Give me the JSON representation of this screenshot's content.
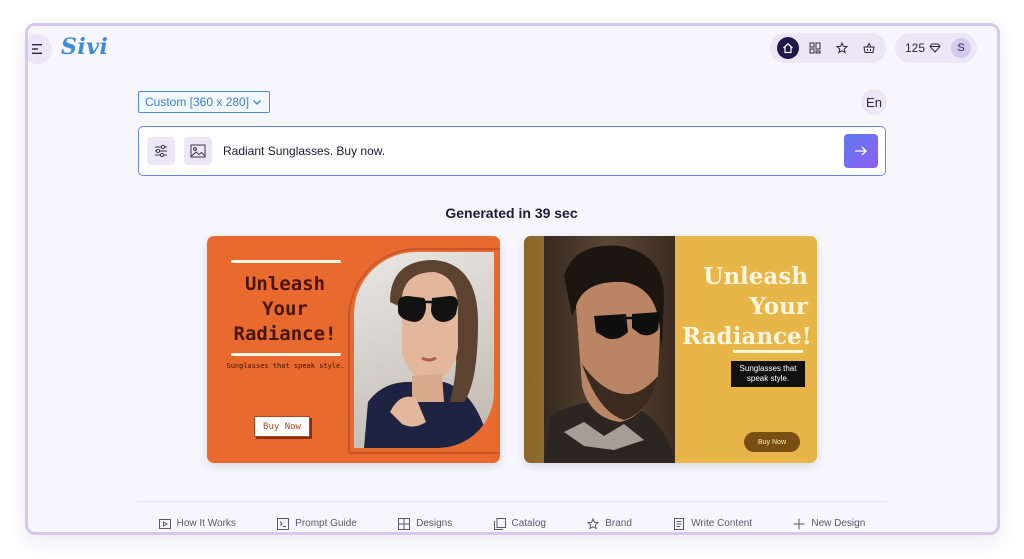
{
  "app": {
    "logo": "Sivi"
  },
  "topbar": {
    "nav_icons": [
      "home-icon",
      "grid-icon",
      "star-icon",
      "basket-icon"
    ],
    "credits": "125",
    "avatar_initial": "S"
  },
  "controls": {
    "size_select": "Custom [360 x 280]",
    "language": "En"
  },
  "prompt": {
    "value": "Radiant Sunglasses. Buy now."
  },
  "generated": {
    "title": "Generated in 39 sec"
  },
  "designs": [
    {
      "headline": [
        "Unleash",
        "Your",
        "Radiance!"
      ],
      "subtitle": "Sunglasses that speak style.",
      "cta": "Buy Now",
      "background": "#e86a2e"
    },
    {
      "headline": [
        "Unleash",
        "Your",
        "Radiance!"
      ],
      "subtitle": [
        "Sunglasses that",
        "speak style."
      ],
      "cta": "Buy Now",
      "background": "#e8b548"
    }
  ],
  "footer": {
    "items": [
      {
        "label": "How It Works",
        "icon": "play-icon"
      },
      {
        "label": "Prompt Guide",
        "icon": "prompt-icon"
      },
      {
        "label": "Designs",
        "icon": "designs-icon"
      },
      {
        "label": "Catalog",
        "icon": "catalog-icon"
      },
      {
        "label": "Brand",
        "icon": "star-icon"
      },
      {
        "label": "Write Content",
        "icon": "document-icon"
      },
      {
        "label": "New Design",
        "icon": "plus-icon"
      }
    ]
  },
  "colors": {
    "accent": "#3d8bd9",
    "send_gradient_start": "#5a7bf2",
    "send_gradient_end": "#8f5df0",
    "frame_border": "#d9c7f2"
  }
}
